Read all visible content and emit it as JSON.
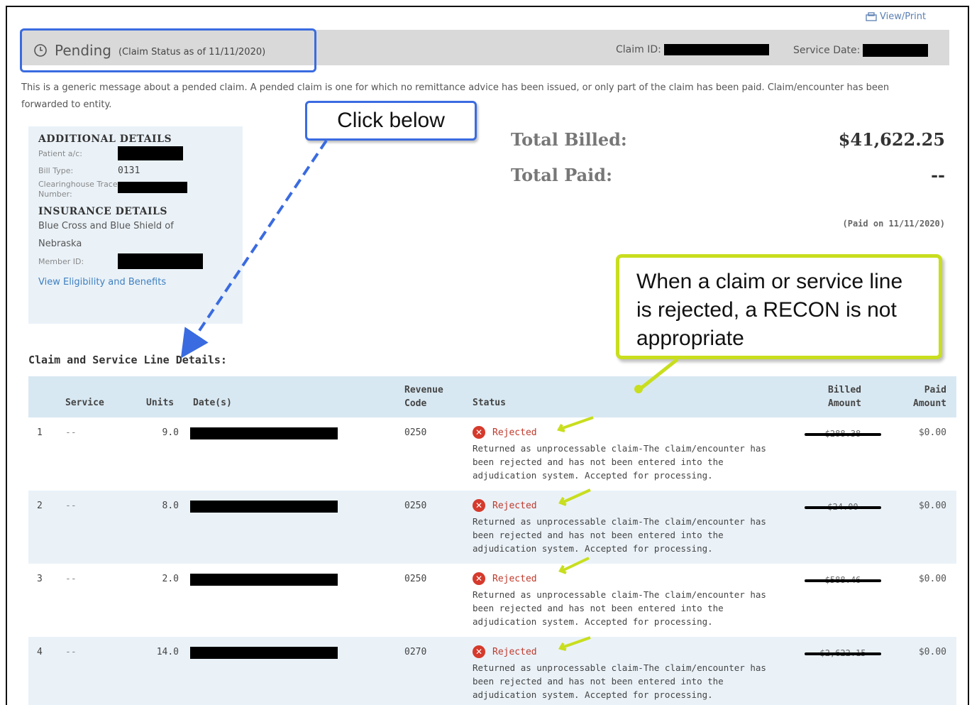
{
  "header": {
    "view_print": "View/Print",
    "pending_label": "Pending",
    "pending_asof": "(Claim Status as of 11/11/2020)",
    "claim_id_label": "Claim ID:",
    "service_date_label": "Service Date:"
  },
  "message": "This is a generic message about a pended claim. A pended claim is one for which no remittance advice has been issued, or only part of the claim has been paid. Claim/encounter has been forwarded to entity.",
  "callouts": {
    "click_below": "Click below",
    "recon_note": "When a claim or service line is rejected, a RECON is not appropriate"
  },
  "additional_details": {
    "heading": "ADDITIONAL DETAILS",
    "patient_ac_label": "Patient a/c:",
    "bill_type_label": "Bill Type:",
    "bill_type_value": "0131",
    "clearinghouse_label": "Clearinghouse Trace Number:"
  },
  "insurance_details": {
    "heading": "INSURANCE DETAILS",
    "name": "Blue Cross and Blue Shield of Nebraska",
    "member_id_label": "Member ID:",
    "eligibility_link": "View Eligibility and Benefits"
  },
  "totals": {
    "billed_label": "Total Billed:",
    "billed_value": "$41,622.25",
    "paid_label": "Total Paid:",
    "paid_value": "--",
    "paid_on": "(Paid on 11/11/2020)"
  },
  "table": {
    "title": "Claim and Service Line Details:",
    "headers": {
      "service": "Service",
      "units": "Units",
      "dates": "Date(s)",
      "revenue_code_1": "Revenue",
      "revenue_code_2": "Code",
      "status": "Status",
      "billed_1": "Billed",
      "billed_2": "Amount",
      "paid_1": "Paid",
      "paid_2": "Amount"
    },
    "rows": [
      {
        "num": "1",
        "service": "--",
        "units": "9.0",
        "revenue_code": "0250",
        "status": "Rejected",
        "status_desc": "Returned as unprocessable claim-The claim/encounter has been rejected and has not been entered into the adjudication system. Accepted for processing.",
        "billed": "$288.38",
        "paid": "$0.00"
      },
      {
        "num": "2",
        "service": "--",
        "units": "8.0",
        "revenue_code": "0250",
        "status": "Rejected",
        "status_desc": "Returned as unprocessable claim-The claim/encounter has been rejected and has not been entered into the adjudication system. Accepted for processing.",
        "billed": "$24.00",
        "paid": "$0.00"
      },
      {
        "num": "3",
        "service": "--",
        "units": "2.0",
        "revenue_code": "0250",
        "status": "Rejected",
        "status_desc": "Returned as unprocessable claim-The claim/encounter has been rejected and has not been entered into the adjudication system. Accepted for processing.",
        "billed": "$588.46",
        "paid": "$0.00"
      },
      {
        "num": "4",
        "service": "--",
        "units": "14.0",
        "revenue_code": "0270",
        "status": "Rejected",
        "status_desc": "Returned as unprocessable claim-The claim/encounter has been rejected and has not been entered into the adjudication system. Accepted for processing.",
        "billed": "$2,622.15",
        "paid": "$0.00"
      }
    ]
  },
  "colors": {
    "callout_blue": "#3a6be0",
    "callout_yellow": "#c8de1e",
    "rejected_red": "#d53a2c",
    "header_gray": "#d9d9d9",
    "table_header_blue": "#d8e8f2",
    "row_alt_blue": "#eaf2f8"
  }
}
